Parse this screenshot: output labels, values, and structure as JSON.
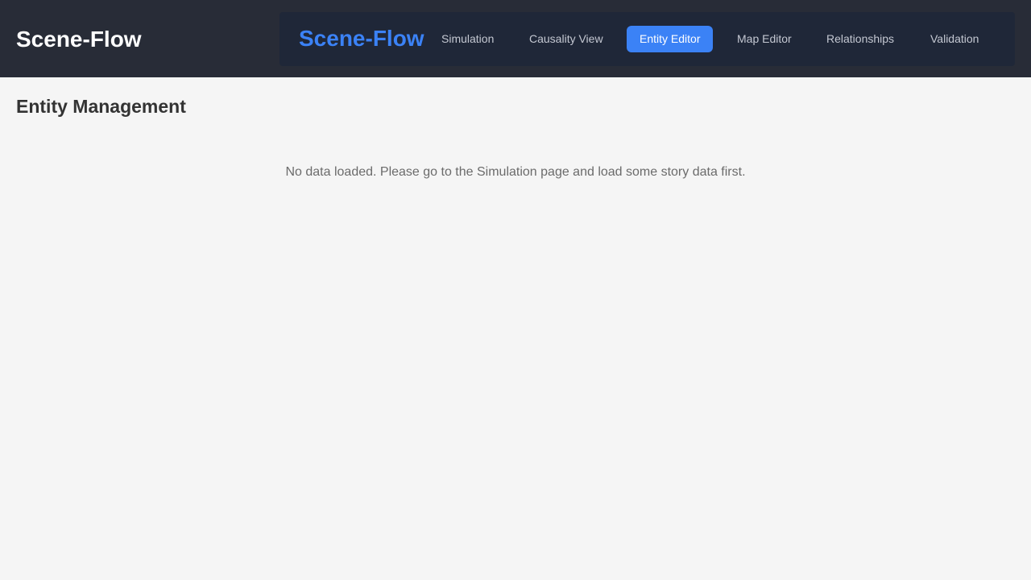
{
  "header": {
    "app_title": "Scene-Flow"
  },
  "nav": {
    "brand": "Scene-Flow",
    "tabs": [
      {
        "label": "Simulation",
        "active": false
      },
      {
        "label": "Causality View",
        "active": false
      },
      {
        "label": "Entity Editor",
        "active": true
      },
      {
        "label": "Map Editor",
        "active": false
      },
      {
        "label": "Relationships",
        "active": false
      },
      {
        "label": "Validation",
        "active": false
      }
    ]
  },
  "main": {
    "title": "Entity Management",
    "empty_message": "No data loaded. Please go to the Simulation page and load some story data first."
  },
  "colors": {
    "topbar_bg": "#282c37",
    "nav_panel_bg": "#1f2738",
    "accent": "#3b82f6",
    "page_bg": "#f5f5f5",
    "title_text": "#333333",
    "muted_text": "#6b6b6b"
  }
}
